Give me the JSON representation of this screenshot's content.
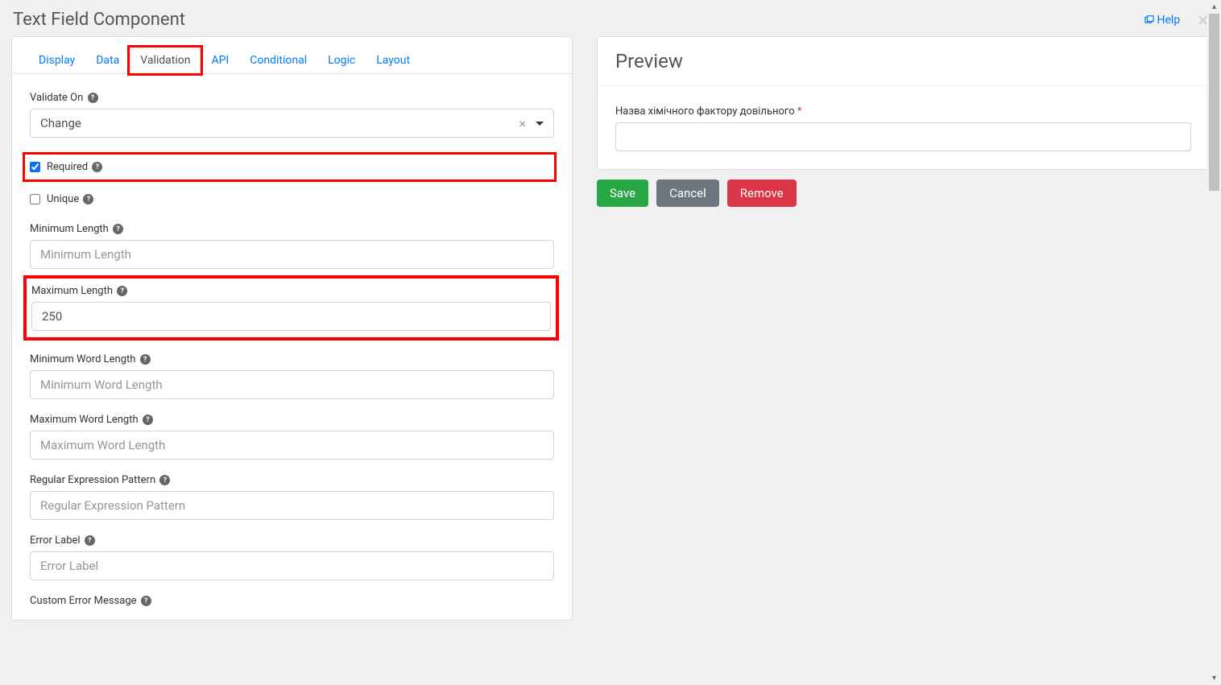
{
  "title": "Text Field Component",
  "help_label": "Help",
  "tabs": [
    {
      "label": "Display",
      "active": false
    },
    {
      "label": "Data",
      "active": false
    },
    {
      "label": "Validation",
      "active": true
    },
    {
      "label": "API",
      "active": false
    },
    {
      "label": "Conditional",
      "active": false
    },
    {
      "label": "Logic",
      "active": false
    },
    {
      "label": "Layout",
      "active": false
    }
  ],
  "fields": {
    "validate_on": {
      "label": "Validate On",
      "value": "Change"
    },
    "required": {
      "label": "Required",
      "checked": true
    },
    "unique": {
      "label": "Unique",
      "checked": false
    },
    "min_length": {
      "label": "Minimum Length",
      "placeholder": "Minimum Length",
      "value": ""
    },
    "max_length": {
      "label": "Maximum Length",
      "placeholder": "Maximum Length",
      "value": "250"
    },
    "min_word_length": {
      "label": "Minimum Word Length",
      "placeholder": "Minimum Word Length",
      "value": ""
    },
    "max_word_length": {
      "label": "Maximum Word Length",
      "placeholder": "Maximum Word Length",
      "value": ""
    },
    "regex_pattern": {
      "label": "Regular Expression Pattern",
      "placeholder": "Regular Expression Pattern",
      "value": ""
    },
    "error_label": {
      "label": "Error Label",
      "placeholder": "Error Label",
      "value": ""
    },
    "custom_error": {
      "label": "Custom Error Message"
    }
  },
  "preview": {
    "title": "Preview",
    "field_label": "Назва хімічного фактору довільного"
  },
  "buttons": {
    "save": "Save",
    "cancel": "Cancel",
    "remove": "Remove"
  }
}
